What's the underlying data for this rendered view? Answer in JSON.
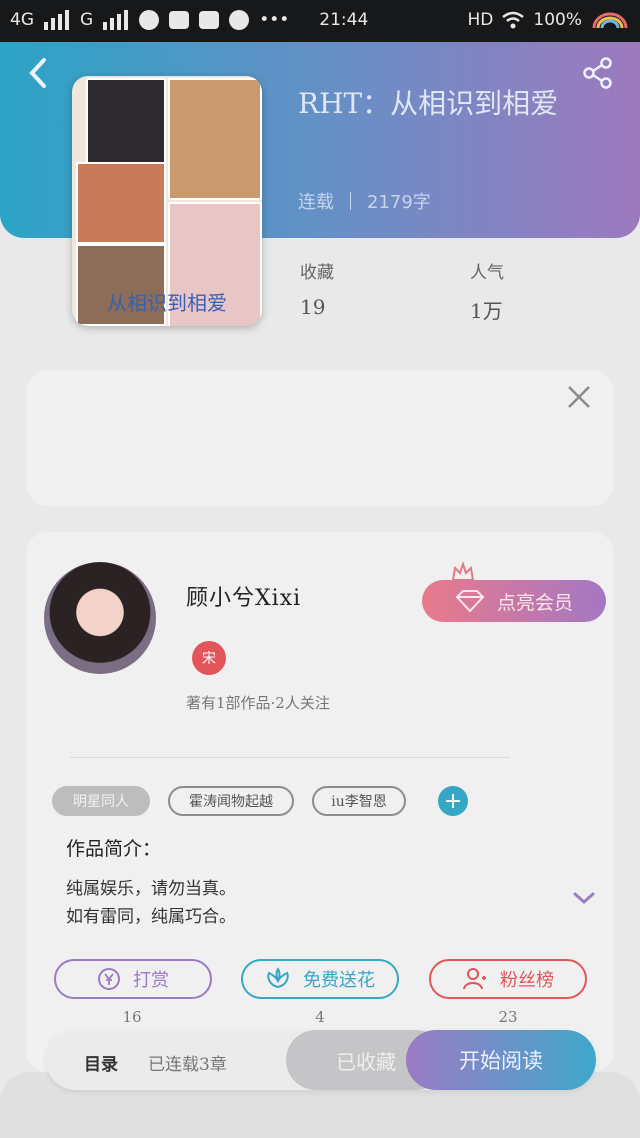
{
  "status_bar": {
    "network1": "4G",
    "network2": "G",
    "more": "•••",
    "time": "21:44",
    "hd": "HD",
    "battery": "100%"
  },
  "book": {
    "title": "RHT：从相识到相爱",
    "cover_caption": "从相识到相爱",
    "status": "连载",
    "word_count": "2179字",
    "stats": [
      {
        "label": "收藏",
        "value": "19"
      },
      {
        "label": "人气",
        "value": "1万"
      }
    ]
  },
  "author": {
    "name": "顾小兮Xixi",
    "badge": "宋",
    "works": "著有1部作品·2人关注",
    "vip_label": "点亮会员"
  },
  "tags": [
    {
      "label": "明星同人",
      "style": "filled"
    },
    {
      "label": "霍涛闻物起越",
      "style": "outline"
    },
    {
      "label": "iu李智恩",
      "style": "outline"
    }
  ],
  "intro": {
    "heading": "作品简介：",
    "lines": [
      "纯属娱乐，请勿当真。",
      "如有雷同，纯属巧合。"
    ]
  },
  "actions": [
    {
      "label": "打赏",
      "count": "16",
      "color": "#9b7bc4"
    },
    {
      "label": "免费送花",
      "count": "4",
      "color": "#36a7c4"
    },
    {
      "label": "粉丝榜",
      "count": "23",
      "color": "#e2555a"
    }
  ],
  "bottom_bar": {
    "toc": "目录",
    "toc_sub": "已连载3章",
    "collected": "已收藏",
    "read": "开始阅读"
  },
  "icons": {
    "back": "chevron-left-icon",
    "share": "share-icon",
    "close": "close-icon",
    "expand": "chevron-down-icon",
    "crown": "crown-icon",
    "diamond": "diamond-icon",
    "reward": "yen-icon",
    "flower": "flower-icon",
    "fans": "person-icon"
  }
}
